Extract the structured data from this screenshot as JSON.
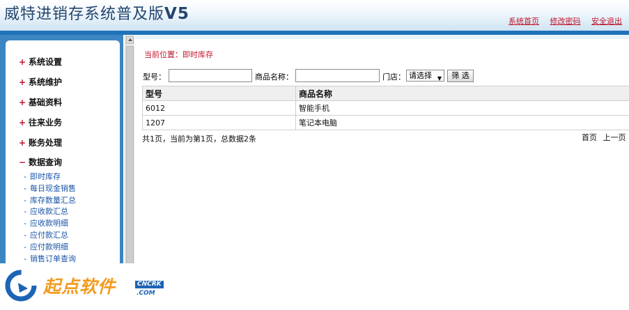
{
  "header": {
    "title": "威特进销存系统普及版",
    "version": "V5",
    "links": [
      "系统首页",
      "修改密码",
      "安全退出"
    ]
  },
  "sidebar": {
    "groups": [
      {
        "sign": "+",
        "label": "系统设置"
      },
      {
        "sign": "+",
        "label": "系统维护"
      },
      {
        "sign": "+",
        "label": "基础资料"
      },
      {
        "sign": "+",
        "label": "往来业务"
      },
      {
        "sign": "+",
        "label": "账务处理"
      },
      {
        "sign": "−",
        "label": "数据查询"
      }
    ],
    "sub_dash": "-",
    "sub_items": [
      "即时库存",
      "每日现金销售",
      "库存数量汇总",
      "应收款汇总",
      "应收款明细",
      "应付款汇总",
      "应付款明细",
      "销售订单查询"
    ]
  },
  "content": {
    "breadcrumb": "当前位置：即时库存",
    "filter": {
      "model_label": "型号：",
      "model_value": "",
      "name_label": "商品名称：",
      "name_value": "",
      "store_label": "门店：",
      "store_selected": "请选择",
      "submit_label": "筛 选"
    },
    "table": {
      "columns": [
        "型号",
        "商品名称"
      ],
      "rows": [
        [
          "6012",
          "智能手机"
        ],
        [
          "1207",
          "笔记本电脑"
        ]
      ]
    },
    "pager": {
      "info": "共1页，当前为第1页，总数据2条",
      "first": "首页",
      "prev": "上一页"
    }
  },
  "watermark": {
    "text": "起点软件",
    "badge": "CNCRK",
    "sub": ".COM"
  },
  "colors": {
    "accent_blue": "#1f73b8",
    "sidebar_bg": "#3c85c3",
    "link_red": "#c0142b",
    "watermark_orange": "#f39a1e"
  }
}
